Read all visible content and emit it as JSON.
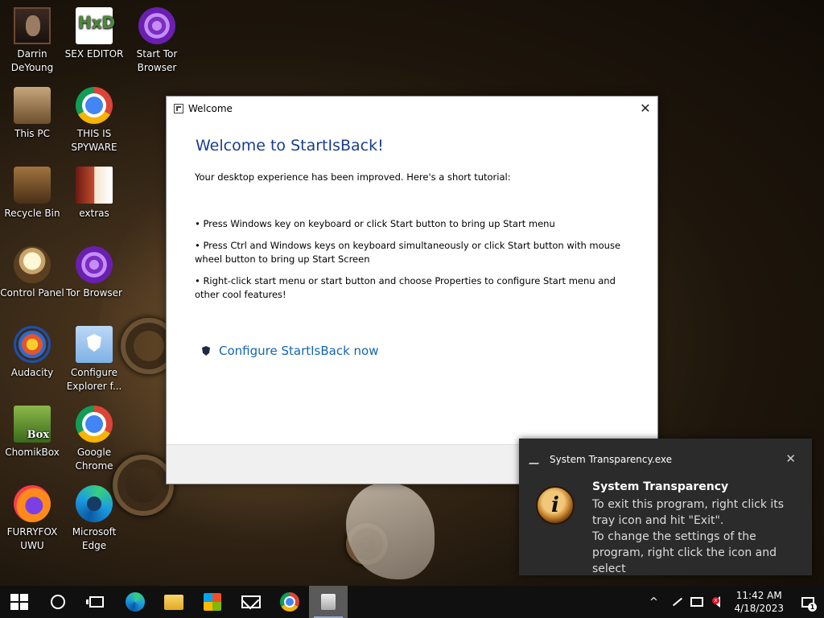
{
  "desktop": {
    "icons": [
      {
        "label": "Darrin DeYoung",
        "icon": "portrait-icon"
      },
      {
        "label": "SEX EDITOR",
        "icon": "hxd-editor-icon"
      },
      {
        "label": "Start Tor Browser",
        "icon": "tor-icon"
      },
      {
        "label": "This PC",
        "icon": "computer-icon"
      },
      {
        "label": "THIS IS SPYWARE",
        "icon": "chrome-icon"
      },
      {
        "label": "Recycle Bin",
        "icon": "recycle-bin-icon"
      },
      {
        "label": "extras",
        "icon": "extras-icon"
      },
      {
        "label": "Control Panel",
        "icon": "control-panel-icon"
      },
      {
        "label": "Tor Browser",
        "icon": "tor-icon"
      },
      {
        "label": "Audacity",
        "icon": "audacity-icon"
      },
      {
        "label": "Configure Explorer f...",
        "icon": "shield-folder-icon"
      },
      {
        "label": "ChomikBox",
        "icon": "chomikbox-icon"
      },
      {
        "label": "Google Chrome",
        "icon": "chrome-icon"
      },
      {
        "label": "FURRYFOX UWU",
        "icon": "firefox-icon"
      },
      {
        "label": "Microsoft Edge",
        "icon": "edge-icon"
      }
    ],
    "hxd_glyph": "HxD",
    "chomik_glyph": "Box"
  },
  "dialog": {
    "title": "Welcome",
    "close_glyph": "✕",
    "heading": "Welcome to StartIsBack!",
    "intro": "Your desktop experience has been improved. Here's a short tutorial:",
    "bullets": [
      "• Press Windows key on keyboard or click Start button to bring up Start menu",
      "• Press Ctrl and Windows keys on keyboard simultaneously or click Start button with mouse wheel button to bring up Start Screen",
      "• Right-click start menu or start button and choose Properties to configure Start menu and other cool features!"
    ],
    "link": "Configure StartIsBack now"
  },
  "toast": {
    "app": "System Transparency.exe",
    "close_glyph": "✕",
    "icon_glyph": "i",
    "title": "System Transparency",
    "body": "To exit this program, right click its tray icon and hit \"Exit\".\nTo change the settings of the program, right click the icon and select"
  },
  "taskbar": {
    "pinned": [
      "start-button",
      "search-button",
      "task-view-button",
      "edge",
      "file-explorer",
      "microsoft-store",
      "mail",
      "chrome",
      "system-transparency"
    ],
    "tray": {
      "chevron": "^",
      "time": "11:42 AM",
      "date": "4/18/2023",
      "volume_badge": "x",
      "notification_count": "1"
    }
  }
}
